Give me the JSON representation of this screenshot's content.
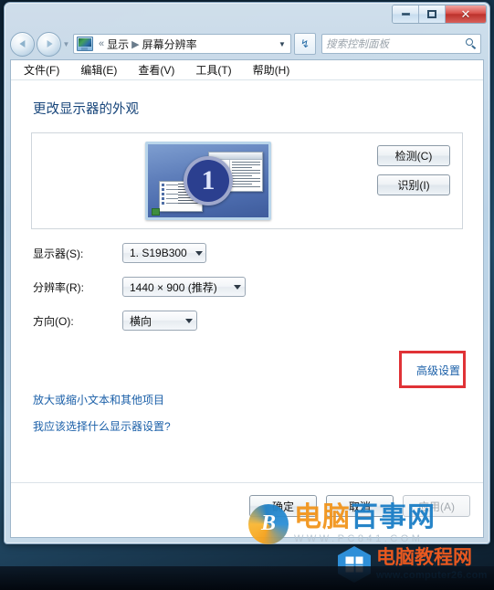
{
  "window": {
    "controls": {
      "minimize": "minimize-icon",
      "maximize": "maximize-icon",
      "close": "✕"
    }
  },
  "nav": {
    "back_icon": "back-arrow-icon",
    "forward_icon": "forward-arrow-icon",
    "history_caret": "▼",
    "address": {
      "icon": "display-control-panel-icon",
      "separator_lead": "«",
      "crumb1": "显示",
      "crumb_sep": "▶",
      "crumb2": "屏幕分辨率",
      "caret": "▼"
    },
    "refresh_icon": "↯",
    "search": {
      "placeholder": "搜索控制面板",
      "icon": "search-icon"
    }
  },
  "menubar": {
    "items": [
      {
        "label": "文件(F)"
      },
      {
        "label": "编辑(E)"
      },
      {
        "label": "查看(V)"
      },
      {
        "label": "工具(T)"
      },
      {
        "label": "帮助(H)"
      }
    ]
  },
  "page": {
    "title": "更改显示器的外观",
    "monitor_badge": "1",
    "buttons": {
      "detect": "检测(C)",
      "identify": "识别(I)"
    },
    "fields": {
      "monitor": {
        "label": "显示器(S):",
        "value": "1. S19B300"
      },
      "resolution": {
        "label": "分辨率(R):",
        "value": "1440 × 900 (推荐)"
      },
      "orientation": {
        "label": "方向(O):",
        "value": "横向"
      }
    },
    "advanced_link": "高级设置",
    "links": [
      {
        "label": "放大或缩小文本和其他项目"
      },
      {
        "label": "我应该选择什么显示器设置?"
      }
    ],
    "footer": {
      "ok": "确定",
      "cancel": "取消",
      "apply": "应用(A)"
    }
  },
  "annotation": {
    "highlight_color": "#e03236"
  },
  "watermarks": {
    "primary": {
      "logo_letter": "B",
      "text_part1": "电脑",
      "text_part2": "百事网",
      "url": "WWW.PC841.COM"
    },
    "secondary": {
      "text": "电脑教程网",
      "url": "www.computer26.com"
    }
  }
}
